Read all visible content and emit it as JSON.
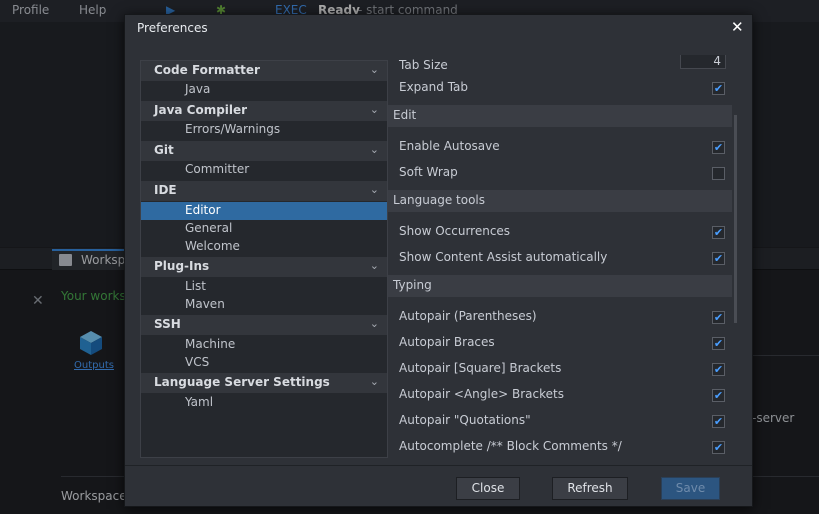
{
  "menubar": {
    "profile": "Profile",
    "help": "Help"
  },
  "toolbar": {
    "exec": "EXEC",
    "status": "Ready",
    "status_detail": "- start command"
  },
  "workspace": {
    "tab_label": "Worksp",
    "message": "Your works",
    "outputs_label": "Outputs",
    "server_text": "-server",
    "footer_label": "Workspace"
  },
  "dialog": {
    "title": "Preferences",
    "close_glyph": "✕",
    "tree": [
      {
        "label": "Code Formatter",
        "items": [
          "Java"
        ]
      },
      {
        "label": "Java Compiler",
        "items": [
          "Errors/Warnings"
        ]
      },
      {
        "label": "Git",
        "items": [
          "Committer"
        ]
      },
      {
        "label": "IDE",
        "items": [
          "Editor",
          "General",
          "Welcome"
        ],
        "selected": "Editor"
      },
      {
        "label": "Plug-Ins",
        "items": [
          "List",
          "Maven"
        ]
      },
      {
        "label": "SSH",
        "items": [
          "Machine",
          "VCS"
        ]
      },
      {
        "label": "Language Server Settings",
        "items": [
          "Yaml"
        ]
      }
    ],
    "settings": {
      "tab_size_label": "Tab Size",
      "tab_size_value": "4",
      "expand_tab_label": "Expand Tab",
      "expand_tab": true,
      "sections": {
        "edit": "Edit",
        "language_tools": "Language tools",
        "typing": "Typing"
      },
      "enable_autosave_label": "Enable Autosave",
      "enable_autosave": true,
      "soft_wrap_label": "Soft Wrap",
      "soft_wrap": false,
      "show_occurrences_label": "Show Occurrences",
      "show_occurrences": true,
      "show_content_assist_label": "Show Content Assist automatically",
      "show_content_assist": true,
      "autopair_parentheses_label": "Autopair (Parentheses)",
      "autopair_parentheses": true,
      "autopair_braces_label": "Autopair Braces",
      "autopair_braces": true,
      "autopair_square_label": "Autopair [Square] Brackets",
      "autopair_square": true,
      "autopair_angle_label": "Autopair <Angle> Brackets",
      "autopair_angle": true,
      "autopair_quotations_label": "Autopair \"Quotations\"",
      "autopair_quotations": true,
      "autocomplete_block_comments_label": "Autocomplete /** Block Comments */",
      "autocomplete_block_comments": true
    },
    "buttons": {
      "close": "Close",
      "refresh": "Refresh",
      "save": "Save"
    },
    "checkmark_glyph": "✔",
    "chevron_glyph": "⌄"
  }
}
